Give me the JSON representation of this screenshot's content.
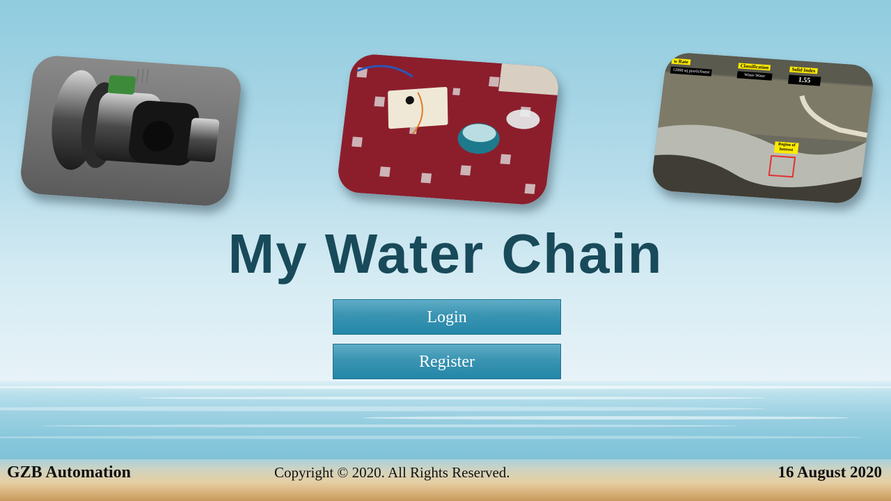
{
  "title": "My Water Chain",
  "buttons": {
    "login": "Login",
    "register": "Register"
  },
  "footer": {
    "company": "GZB Automation",
    "copyright": "Copyright © 2020. All Rights Reserved.",
    "date": "16 August 2020"
  },
  "photos": {
    "sensor": {
      "icon": "flow-sensor-image"
    },
    "breadboard": {
      "icon": "breadboard-prototype-image"
    },
    "riverbank": {
      "icon": "water-monitoring-image",
      "overlay": {
        "flow_label": "w Rate",
        "flow_value": "12000 sq pixels/frame",
        "class_label": "Classification",
        "class_value": "Waste Water",
        "index_label": "Solid Index",
        "index_value": "1.55",
        "roi_label": "Region of Interest"
      }
    }
  },
  "colors": {
    "title": "#184a5a",
    "button": "#2487a8",
    "sky_top": "#8fcbde",
    "sand": "#d8b27a",
    "roi_box": "#e53030"
  }
}
